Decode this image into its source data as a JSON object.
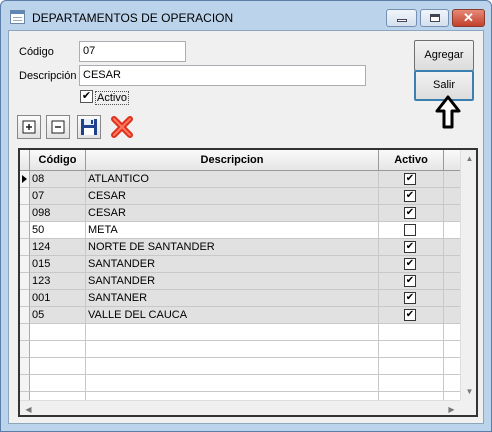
{
  "window": {
    "title": "DEPARTAMENTOS DE OPERACION",
    "controls": {
      "minimize": "minimize",
      "maximize": "maximize",
      "close": "✕"
    }
  },
  "form": {
    "codigo_label": "Código",
    "codigo_value": "07",
    "descripcion_label": "Descripción",
    "descripcion_value": "CESAR",
    "activo_label": "Activo",
    "activo_checked": true
  },
  "buttons": {
    "agregar": "Agregar",
    "salir": "Salir"
  },
  "toolbar": {
    "add_icon": "plus-icon",
    "remove_icon": "minus-icon",
    "save_icon": "floppy-disk-icon",
    "delete_icon": "red-x-icon"
  },
  "grid": {
    "columns": [
      "Código",
      "Descripcion",
      "Activo"
    ],
    "rows": [
      {
        "codigo": "08",
        "descripcion": "ATLANTICO",
        "activo": true
      },
      {
        "codigo": "07",
        "descripcion": "CESAR",
        "activo": true
      },
      {
        "codigo": "098",
        "descripcion": "CESAR",
        "activo": true
      },
      {
        "codigo": "50",
        "descripcion": "META",
        "activo": false
      },
      {
        "codigo": "124",
        "descripcion": "NORTE DE SANTANDER",
        "activo": true
      },
      {
        "codigo": "015",
        "descripcion": "SANTANDER",
        "activo": true
      },
      {
        "codigo": "123",
        "descripcion": "SANTANDER",
        "activo": true
      },
      {
        "codigo": "001",
        "descripcion": "SANTANER",
        "activo": true
      },
      {
        "codigo": "05",
        "descripcion": "VALLE DEL CAUCA",
        "activo": true
      }
    ],
    "empty_rows": 5,
    "current_row": 0
  },
  "colors": {
    "title_bar": "#bcd3ec",
    "close": "#c3412c",
    "delete_icon": "#e0301e",
    "save_icon": "#1f3f8f"
  }
}
